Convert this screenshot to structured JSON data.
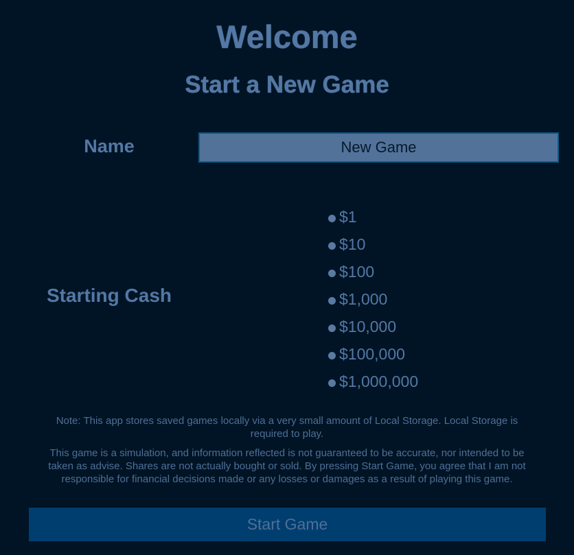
{
  "headings": {
    "welcome": "Welcome",
    "subtitle": "Start a New Game"
  },
  "form": {
    "name_label": "Name",
    "name_value": "New Game",
    "cash_label": "Starting Cash",
    "cash_options": [
      "$1",
      "$10",
      "$100",
      "$1,000",
      "$10,000",
      "$100,000",
      "$1,000,000"
    ]
  },
  "notes": {
    "storage": "Note: This app stores saved games locally via a very small amount of Local Storage. Local Storage is required to play.",
    "disclaimer": "This game is a simulation, and information reflected is not guaranteed to be accurate, nor intended to be taken as advise. Shares are not actually bought or sold. By pressing Start Game, you agree that I am not responsible for financial decisions made or any losses or damages as a result of playing this game."
  },
  "actions": {
    "start_label": "Start Game"
  },
  "colors": {
    "background": "#001425",
    "heading": "#5478a5",
    "input_bg": "#52729a",
    "button_bg": "#003e70"
  }
}
